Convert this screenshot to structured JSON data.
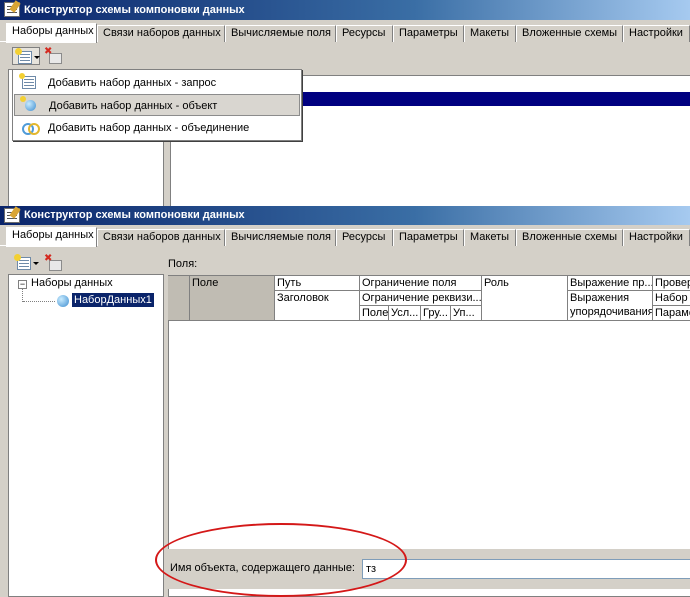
{
  "top_window": {
    "title": "Конструктор схемы компоновки данных",
    "tabs": [
      "Наборы данных",
      "Связи наборов данных",
      "Вычисляемые поля",
      "Ресурсы",
      "Параметры",
      "Макеты",
      "Вложенные схемы",
      "Настройки"
    ],
    "active_tab": "Наборы данных",
    "add_menu": {
      "items": [
        {
          "label": "Добавить набор данных - запрос",
          "icon": "query-dataset-icon",
          "highlighted": false
        },
        {
          "label": "Добавить набор данных - объект",
          "icon": "object-dataset-icon",
          "highlighted": true
        },
        {
          "label": "Добавить набор данных - объединение",
          "icon": "union-dataset-icon",
          "highlighted": false
        }
      ]
    }
  },
  "bottom_window": {
    "title": "Конструктор схемы компоновки данных",
    "tabs": [
      "Наборы данных",
      "Связи наборов данных",
      "Вычисляемые поля",
      "Ресурсы",
      "Параметры",
      "Макеты",
      "Вложенные схемы",
      "Настройки"
    ],
    "active_tab": "Наборы данных",
    "tree": {
      "root": "Наборы данных",
      "children": [
        {
          "label": "НаборДанных1",
          "selected": true
        }
      ]
    },
    "fields_label": "Поля:",
    "grid_headers": {
      "row1": [
        "Поле",
        "Путь",
        "Ограничение поля",
        "Роль",
        "Выражение пр...",
        "Провер"
      ],
      "row2": [
        "Заголовок",
        "Ограничение реквизи...",
        "Выражения упорядочивания",
        "Набор д"
      ],
      "row3": [
        "Поле",
        "Усл...",
        "Гру...",
        "Уп...",
        "Парамет"
      ]
    },
    "object_field": {
      "label": "Имя объекта, содержащего данные:",
      "value": "тз"
    }
  },
  "colors": {
    "title_bar_start": "#0a246a",
    "title_bar_end": "#a6caf0",
    "selection": "#0a246a",
    "annotation_ellipse": "#d41818"
  }
}
